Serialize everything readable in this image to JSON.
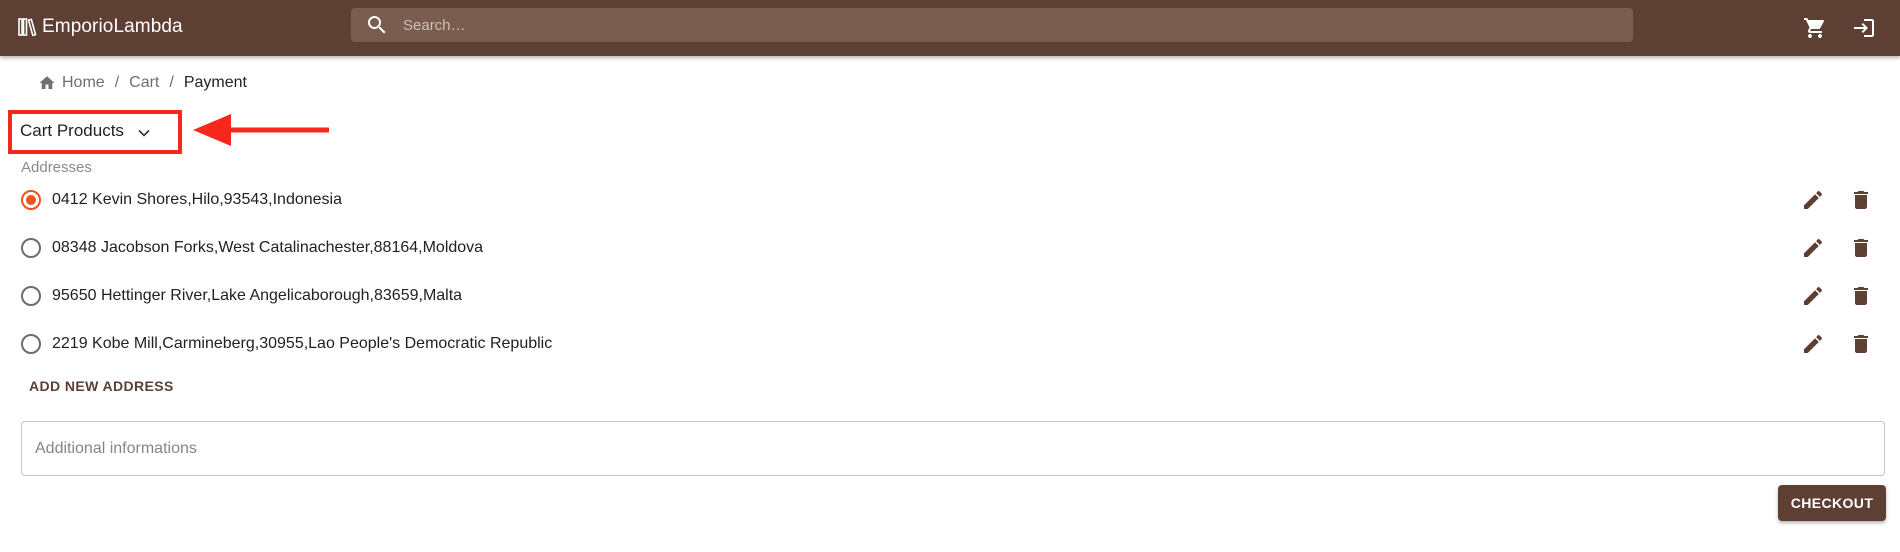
{
  "header": {
    "brand": "EmporioLambda",
    "brand_icon": "library-books-icon",
    "search_placeholder": "Search…",
    "cart_icon": "shopping-cart-icon",
    "login_icon": "login-icon"
  },
  "breadcrumb": {
    "items": [
      "Home",
      "Cart",
      "Payment"
    ],
    "separator": "/"
  },
  "cart_select": {
    "label": "Cart Products"
  },
  "addresses": {
    "title": "Addresses",
    "items": [
      {
        "text": "0412 Kevin Shores,Hilo,93543,Indonesia",
        "selected": true
      },
      {
        "text": "08348 Jacobson Forks,West Catalinachester,88164,Moldova",
        "selected": false
      },
      {
        "text": "95650 Hettinger River,Lake Angelicaborough,83659,Malta",
        "selected": false
      },
      {
        "text": "2219 Kobe Mill,Carmineberg,30955,Lao People's Democratic Republic",
        "selected": false
      }
    ],
    "add_label": "ADD NEW ADDRESS"
  },
  "additional_info": {
    "placeholder": "Additional informations",
    "value": ""
  },
  "checkout_label": "CHECKOUT",
  "colors": {
    "appbar": "#5d4033",
    "accent_radio": "#f0511f",
    "annotation": "#f5281b"
  }
}
